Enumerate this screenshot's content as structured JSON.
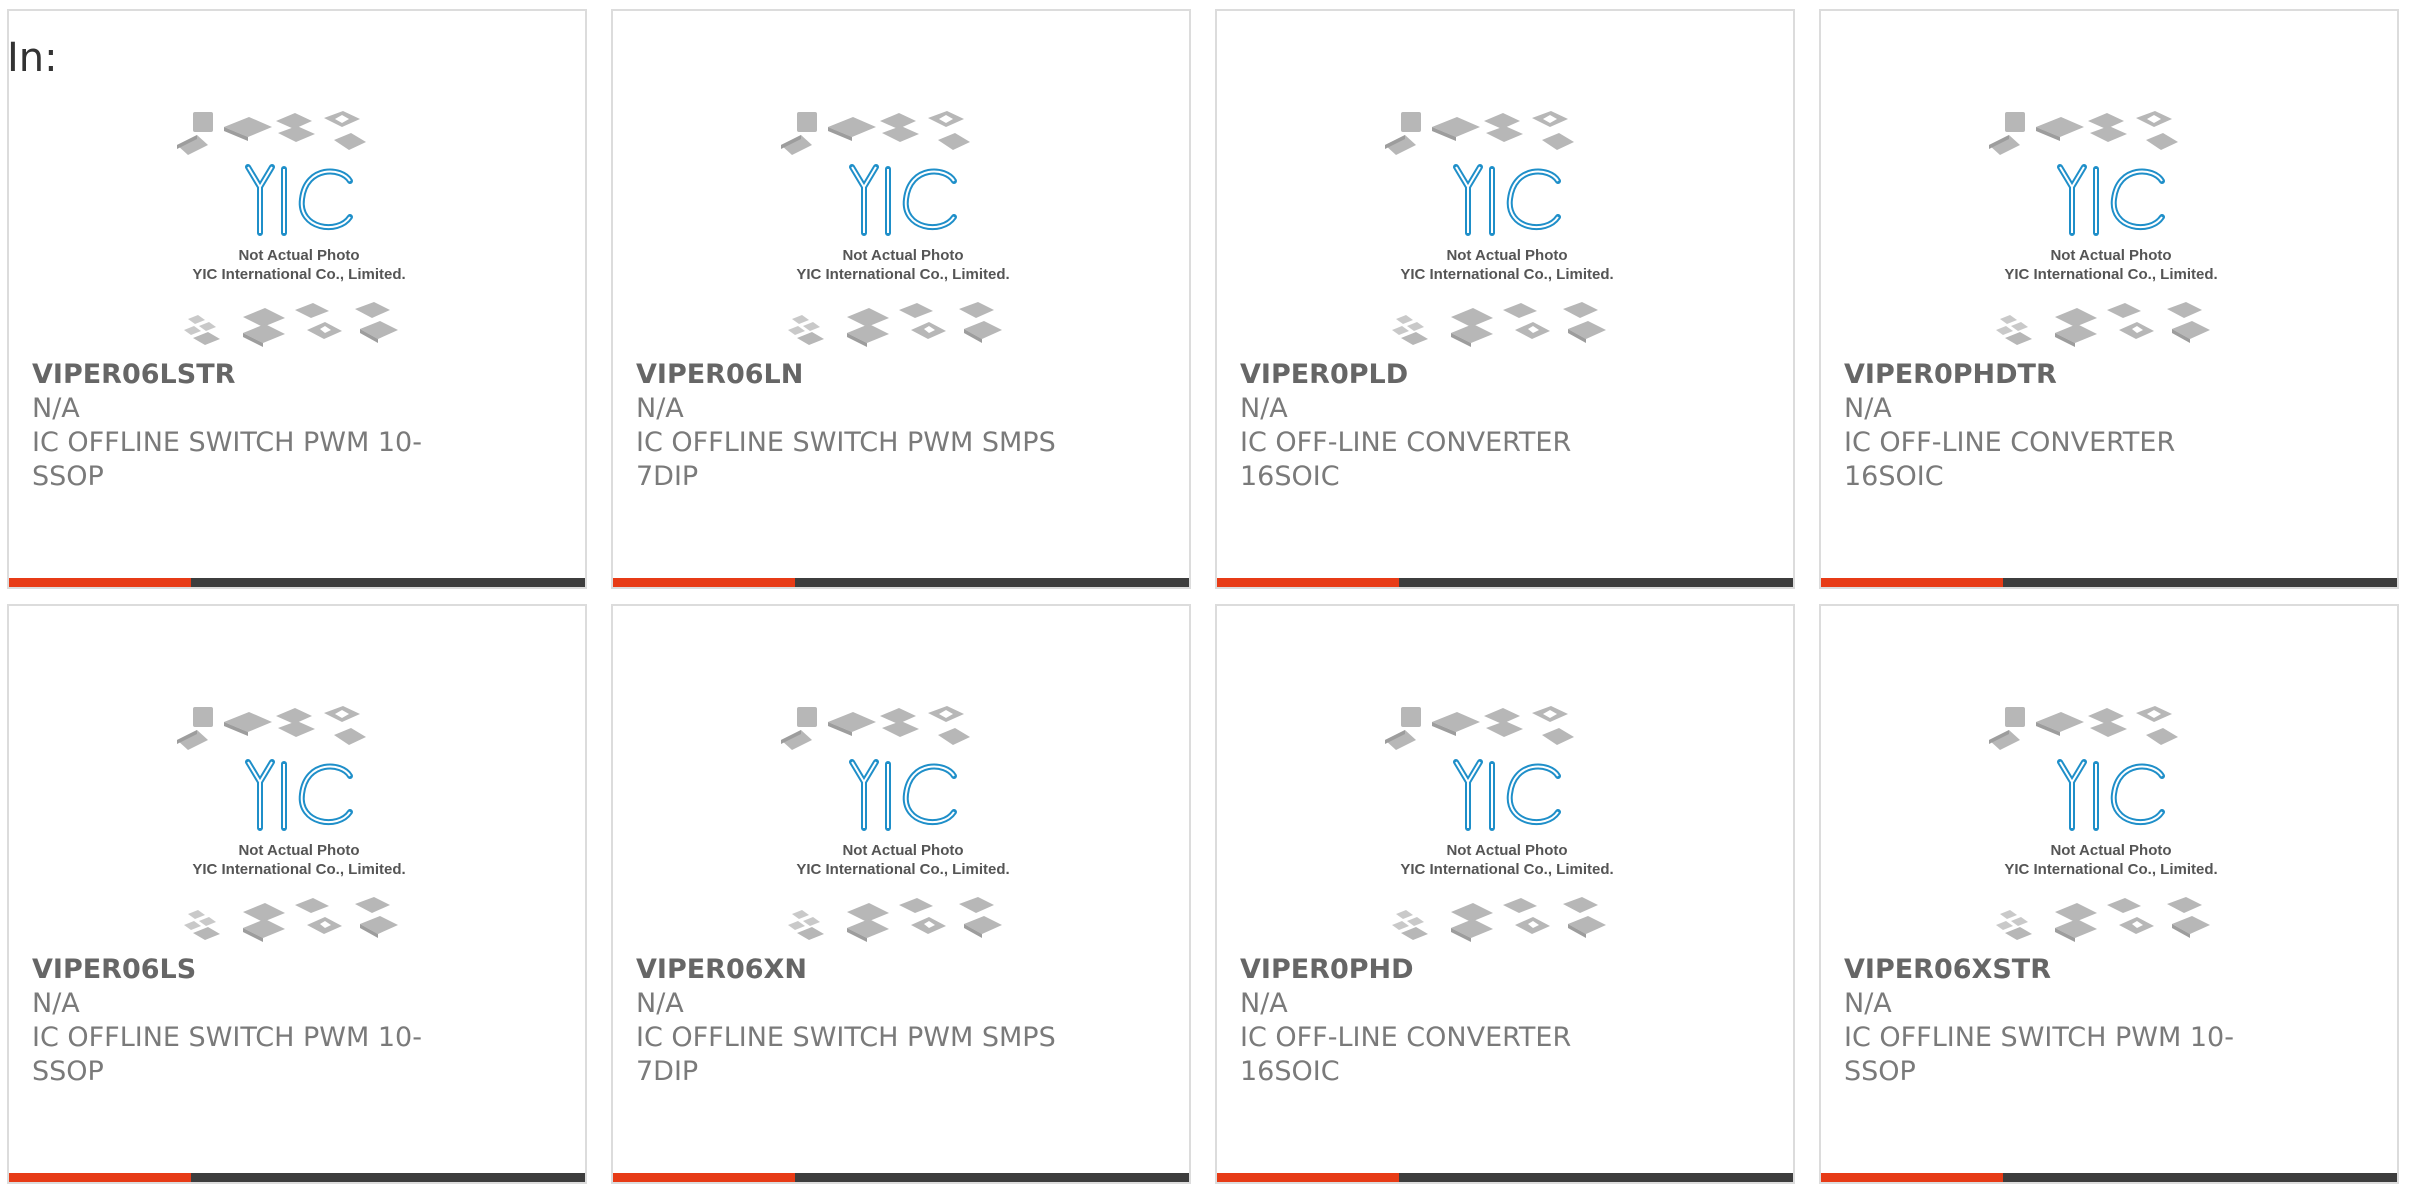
{
  "heading": "In:",
  "placeholder_image": {
    "icon": "yic-placeholder-icon",
    "logo": "YIC",
    "line1": "Not Actual Photo",
    "line2": "YIC International Co., Limited."
  },
  "colors": {
    "accent": "#e73b16",
    "bar": "#3d3d3d",
    "logo_blue": "#1f8fc9",
    "border": "#dcdcdc"
  },
  "products": [
    {
      "part": "VIPER06LSTR",
      "mfr": "N/A",
      "desc": "IC OFFLINE SWITCH PWM 10-SSOP"
    },
    {
      "part": "VIPER06LN",
      "mfr": "N/A",
      "desc": "IC OFFLINE SWITCH PWM SMPS 7DIP"
    },
    {
      "part": "VIPER0PLD",
      "mfr": "N/A",
      "desc": "IC OFF-LINE CONVERTER 16SOIC"
    },
    {
      "part": "VIPER0PHDTR",
      "mfr": "N/A",
      "desc": "IC OFF-LINE CONVERTER 16SOIC"
    },
    {
      "part": "VIPER06LS",
      "mfr": "N/A",
      "desc": "IC OFFLINE SWITCH PWM 10-SSOP"
    },
    {
      "part": "VIPER06XN",
      "mfr": "N/A",
      "desc": "IC OFFLINE SWITCH PWM SMPS 7DIP"
    },
    {
      "part": "VIPER0PHD",
      "mfr": "N/A",
      "desc": "IC OFF-LINE CONVERTER 16SOIC"
    },
    {
      "part": "VIPER06XSTR",
      "mfr": "N/A",
      "desc": "IC OFFLINE SWITCH PWM 10-SSOP"
    }
  ]
}
